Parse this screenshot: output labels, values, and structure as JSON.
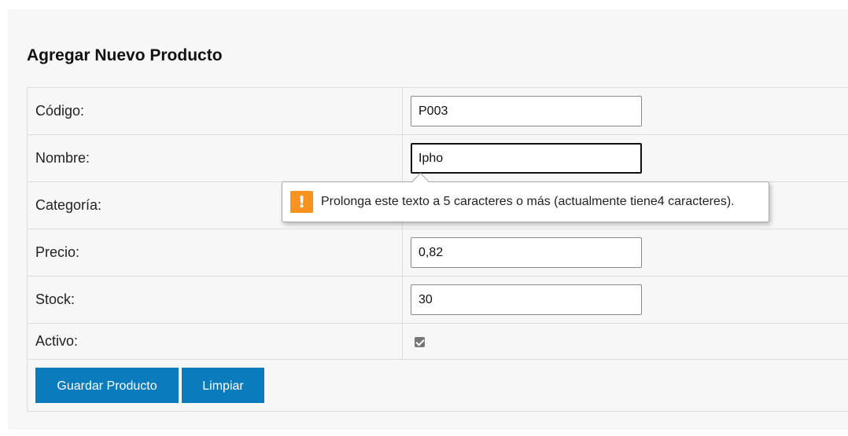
{
  "form": {
    "title": "Agregar Nuevo Producto",
    "fields": {
      "codigo": {
        "label": "Código:",
        "value": "P003"
      },
      "nombre": {
        "label": "Nombre:",
        "value": "Ipho"
      },
      "categoria": {
        "label": "Categoría:"
      },
      "precio": {
        "label": "Precio:",
        "value": "0,82"
      },
      "stock": {
        "label": "Stock:",
        "value": "30"
      },
      "activo": {
        "label": "Activo:",
        "checked": true
      }
    },
    "buttons": {
      "save": "Guardar Producto",
      "clear": "Limpiar"
    }
  },
  "validation_tooltip": {
    "icon": "warning-icon",
    "icon_glyph": "!",
    "message": "Prolonga este texto a 5 caracteres o más (actualmente tiene4 caracteres).",
    "icon_color": "#f7931e"
  },
  "colors": {
    "button": "#0a7bbd",
    "panel": "#f7f7f7"
  }
}
